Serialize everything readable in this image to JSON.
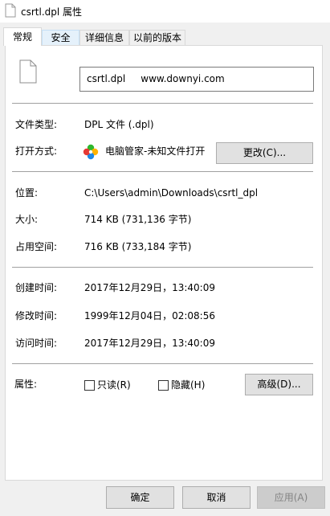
{
  "window": {
    "title": "csrtl.dpl 属性"
  },
  "tabs": [
    {
      "label": "常规",
      "active": true
    },
    {
      "label": "安全",
      "active": false
    },
    {
      "label": "详细信息",
      "active": false
    },
    {
      "label": "以前的版本",
      "active": false
    }
  ],
  "general": {
    "filename": "csrtl.dpl     www.downyi.com",
    "type_label": "文件类型:",
    "type_value": "DPL 文件 (.dpl)",
    "opens_with_label": "打开方式:",
    "opens_with_value": "电脑管家-未知文件打开",
    "change_button": "更改(C)...",
    "location_label": "位置:",
    "location_value": "C:\\Users\\admin\\Downloads\\csrtl_dpl",
    "size_label": "大小:",
    "size_value": "714 KB (731,136 字节)",
    "size_on_disk_label": "占用空间:",
    "size_on_disk_value": "716 KB (733,184 字节)",
    "created_label": "创建时间:",
    "created_value": "2017年12月29日，13:40:09",
    "modified_label": "修改时间:",
    "modified_value": "1999年12月04日，02:08:56",
    "accessed_label": "访问时间:",
    "accessed_value": "2017年12月29日，13:40:09",
    "attributes_label": "属性:",
    "readonly_label": "只读(R)",
    "readonly_checked": false,
    "hidden_label": "隐藏(H)",
    "hidden_checked": false,
    "advanced_button": "高级(D)..."
  },
  "footer": {
    "ok": "确定",
    "cancel": "取消",
    "apply": "应用(A)"
  },
  "colors": {
    "window_bg": "#f0f0f0",
    "panel_bg": "#ffffff",
    "button_bg": "#e1e1e1",
    "hover_tab": "#e5f1fb",
    "disabled_text": "#838383"
  }
}
